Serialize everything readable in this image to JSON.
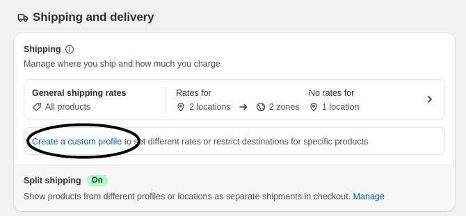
{
  "header": {
    "title": "Shipping and delivery",
    "icon": "truck-icon"
  },
  "shipping": {
    "title": "Shipping",
    "description": "Manage where you ship and how much you charge",
    "general_rates": {
      "label": "General shipping rates",
      "products": "All products"
    },
    "rates_for": {
      "label": "Rates for",
      "locations": "2 locations",
      "zones": "2 zones"
    },
    "no_rates_for": {
      "label": "No rates for",
      "location": "1 location"
    },
    "custom_profile": {
      "link": "Create a custom profile",
      "rest": " to set different rates or restrict destinations for specific products"
    }
  },
  "split_shipping": {
    "title": "Split shipping",
    "badge": "On",
    "description": "Show products from different profiles or locations as separate shipments in checkout.",
    "manage": "Manage"
  },
  "colors": {
    "link": "#005bd3",
    "badge_bg": "#affebf",
    "badge_text": "#0c5132",
    "annotation": "#000000"
  }
}
